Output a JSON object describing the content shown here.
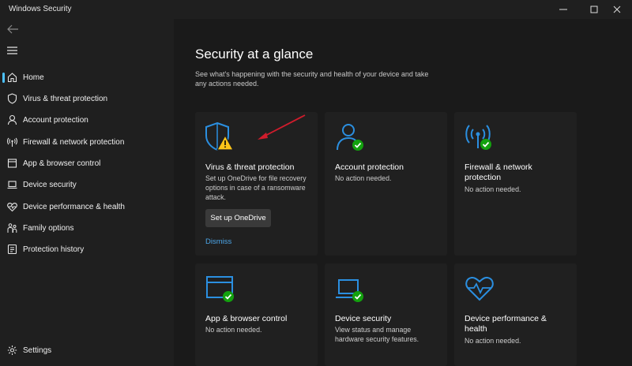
{
  "window": {
    "title": "Windows Security"
  },
  "sidebar": {
    "items": [
      {
        "label": "Home",
        "icon": "home-icon",
        "selected": true
      },
      {
        "label": "Virus & threat protection",
        "icon": "shield-icon"
      },
      {
        "label": "Account protection",
        "icon": "person-icon"
      },
      {
        "label": "Firewall & network protection",
        "icon": "wifi-signal-icon"
      },
      {
        "label": "App & browser control",
        "icon": "browser-window-icon"
      },
      {
        "label": "Device security",
        "icon": "laptop-icon"
      },
      {
        "label": "Device performance & health",
        "icon": "heart-pulse-icon"
      },
      {
        "label": "Family options",
        "icon": "family-icon"
      },
      {
        "label": "Protection history",
        "icon": "history-icon"
      }
    ],
    "settings_label": "Settings"
  },
  "main": {
    "heading": "Security at a glance",
    "subtitle": "See what's happening with the security and health of your device and take any actions needed."
  },
  "cards": [
    {
      "title": "Virus & threat protection",
      "description": "Set up OneDrive for file recovery options in case of a ransomware attack.",
      "status": "warning",
      "button": "Set up OneDrive",
      "link": "Dismiss"
    },
    {
      "title": "Account protection",
      "description": "No action needed.",
      "status": "ok"
    },
    {
      "title": "Firewall & network protection",
      "description": "No action needed.",
      "status": "ok"
    },
    {
      "title": "App & browser control",
      "description": "No action needed.",
      "status": "ok"
    },
    {
      "title": "Device security",
      "description": "View status and manage hardware security features.",
      "status": "ok"
    },
    {
      "title": "Device performance & health",
      "description": "No action needed.",
      "status": "ok"
    }
  ],
  "colors": {
    "accent": "#4cc2ff",
    "icon_blue": "#2b8fe0",
    "ok_green": "#13a10e",
    "warning_yellow": "#fcc419",
    "arrow_red": "#d01c2c"
  }
}
